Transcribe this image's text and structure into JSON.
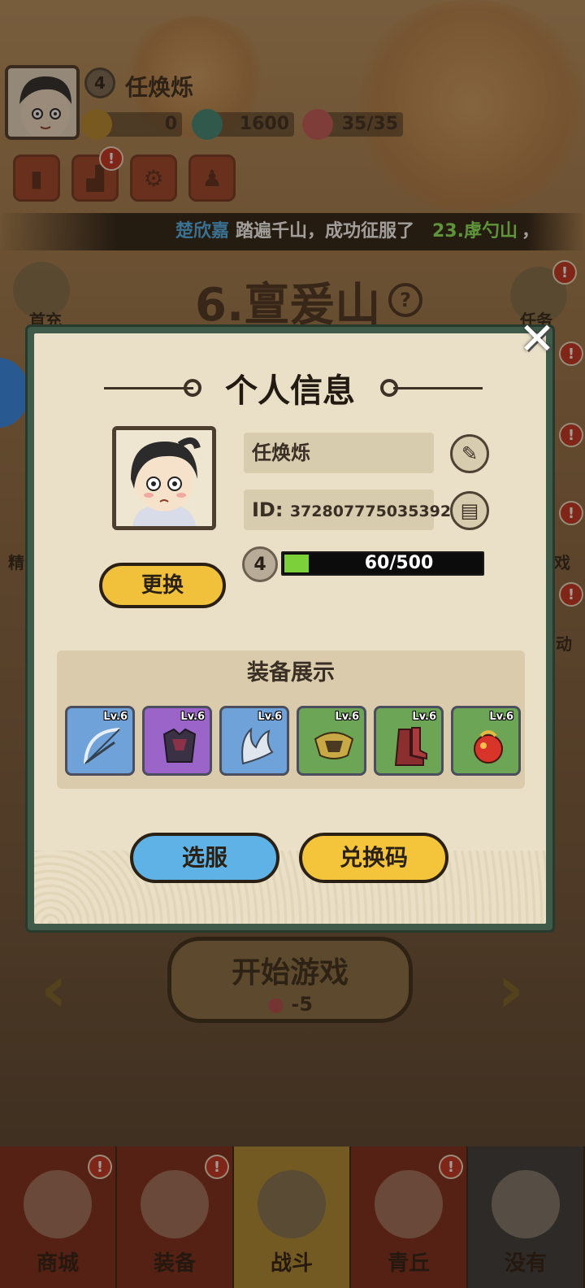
{
  "player": {
    "name": "任焕烁",
    "level": "4",
    "id_label": "ID:",
    "id_value": "372807775035392",
    "xp_text": "60/500",
    "xp_fraction": 0.12
  },
  "resources": [
    {
      "icon": "coin-icon",
      "value": "0"
    },
    {
      "icon": "jade-icon",
      "value": "1600"
    },
    {
      "icon": "peach-stamina-icon",
      "value": "35/35"
    }
  ],
  "ticker": {
    "player": "楚欣嘉",
    "text_1": "踏遍千山，成功征服了",
    "mountain": "23.虖勺山",
    "text_2": "，"
  },
  "stage": {
    "title": "6.亶爰山",
    "help_glyph": "?"
  },
  "side_labels": {
    "left_top": "首充",
    "left_mid": "精",
    "right_top": "任务",
    "right_mid": "戏",
    "right_low": "动"
  },
  "modal": {
    "title": "个人信息",
    "change_button": "更换",
    "equip_title": "装备展示",
    "server_button": "选服",
    "code_button": "兑换码",
    "close_glyph": "✕",
    "edit_glyph": "✎",
    "copy_glyph": "▤",
    "equipment": [
      {
        "name": "bow-icon",
        "level": "Lv.6",
        "color": "#6ea2d8"
      },
      {
        "name": "armor-icon",
        "level": "Lv.6",
        "color": "#9a64c8"
      },
      {
        "name": "claw-icon",
        "level": "Lv.6",
        "color": "#6ea2d8"
      },
      {
        "name": "helmet-icon",
        "level": "Lv.6",
        "color": "#6da557"
      },
      {
        "name": "boots-icon",
        "level": "Lv.6",
        "color": "#6da557"
      },
      {
        "name": "orb-icon",
        "level": "Lv.6",
        "color": "#6da557"
      }
    ]
  },
  "start": {
    "label": "开始游戏",
    "cost": "-5"
  },
  "nav": [
    {
      "label": "商城",
      "icon": "shop-icon",
      "badge": "!"
    },
    {
      "label": "装备",
      "icon": "equipment-icon",
      "badge": "!"
    },
    {
      "label": "战斗",
      "icon": "battle-icon",
      "badge": ""
    },
    {
      "label": "青丘",
      "icon": "mountain-icon",
      "badge": "!"
    },
    {
      "label": "没有",
      "icon": "locked-icon",
      "badge": ""
    }
  ],
  "colors": {
    "accent_yellow": "#f4c53a",
    "accent_blue": "#5fb2e6",
    "xp_green": "#7cd13b",
    "ticker_name": "#4fb4f0",
    "ticker_mountain": "#8cf05a",
    "badge_red": "#c4321f"
  }
}
